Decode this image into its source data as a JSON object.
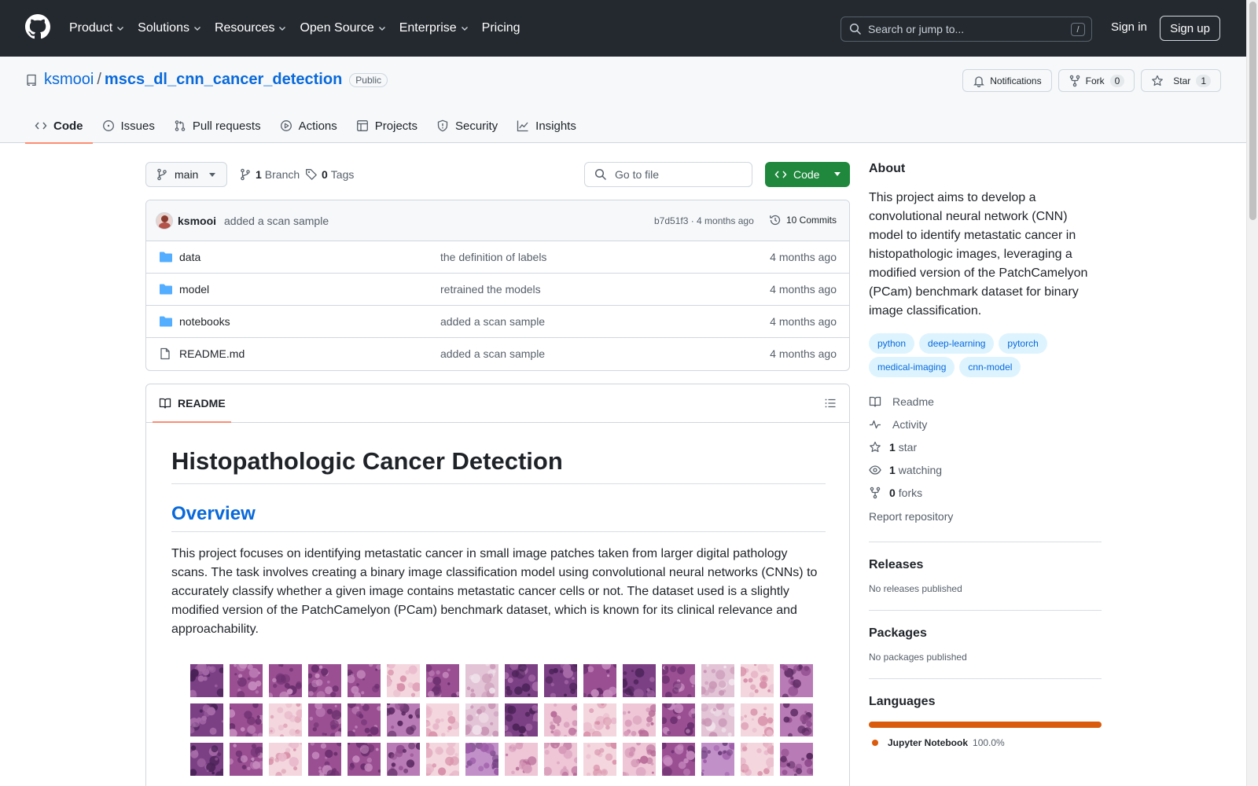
{
  "header": {
    "nav": [
      {
        "label": "Product",
        "has_menu": true
      },
      {
        "label": "Solutions",
        "has_menu": true
      },
      {
        "label": "Resources",
        "has_menu": true
      },
      {
        "label": "Open Source",
        "has_menu": true
      },
      {
        "label": "Enterprise",
        "has_menu": true
      },
      {
        "label": "Pricing",
        "has_menu": false
      }
    ],
    "search_placeholder": "Search or jump to...",
    "search_key": "/",
    "signin": "Sign in",
    "signup": "Sign up"
  },
  "repo": {
    "owner": "ksmooi",
    "separator": "/",
    "name": "mscs_dl_cnn_cancer_detection",
    "visibility": "Public",
    "notifications_label": "Notifications",
    "fork_label": "Fork",
    "fork_count": "0",
    "star_label": "Star",
    "star_count": "1",
    "tabs": [
      {
        "label": "Code",
        "icon": "code-icon",
        "active": true
      },
      {
        "label": "Issues",
        "icon": "issue-icon",
        "active": false
      },
      {
        "label": "Pull requests",
        "icon": "pull-request-icon",
        "active": false
      },
      {
        "label": "Actions",
        "icon": "play-icon",
        "active": false
      },
      {
        "label": "Projects",
        "icon": "table-icon",
        "active": false
      },
      {
        "label": "Security",
        "icon": "shield-icon",
        "active": false
      },
      {
        "label": "Insights",
        "icon": "graph-icon",
        "active": false
      }
    ]
  },
  "toolbar": {
    "branch": "main",
    "branch_count": "1",
    "branch_label": "Branch",
    "tag_count": "0",
    "tag_label": "Tags",
    "goto_placeholder": "Go to file",
    "code_button": "Code"
  },
  "commit": {
    "author": "ksmooi",
    "message": "added a scan sample",
    "hash_time": "b7d51f3 · 4 months ago",
    "commits_label": "10 Commits"
  },
  "files": [
    {
      "name": "data",
      "type": "folder",
      "message": "the definition of labels",
      "date": "4 months ago"
    },
    {
      "name": "model",
      "type": "folder",
      "message": "retrained the models",
      "date": "4 months ago"
    },
    {
      "name": "notebooks",
      "type": "folder",
      "message": "added a scan sample",
      "date": "4 months ago"
    },
    {
      "name": "README.md",
      "type": "file",
      "message": "added a scan sample",
      "date": "4 months ago"
    }
  ],
  "readme": {
    "tab_label": "README",
    "h1": "Histopathologic Cancer Detection",
    "h2": "Overview",
    "paragraph": "This project focuses on identifying metastatic cancer in small image patches taken from larger digital pathology scans. The task involves creating a binary image classification model using convolutional neural networks (CNNs) to accurately classify whether a given image contains metastatic cancer cells or not. The dataset used is a slightly modified version of the PatchCamelyon (PCam) benchmark dataset, which is known for its clinical relevance and approachability."
  },
  "sidebar": {
    "about_title": "About",
    "about_text": "This project aims to develop a convolutional neural network (CNN) model to identify metastatic cancer in histopathologic images, leveraging a modified version of the PatchCamelyon (PCam) benchmark dataset for binary image classification.",
    "topics": [
      "python",
      "deep-learning",
      "pytorch",
      "medical-imaging",
      "cnn-model"
    ],
    "links": [
      {
        "icon": "book-icon",
        "count": "",
        "label": "Readme"
      },
      {
        "icon": "pulse-icon",
        "count": "",
        "label": "Activity"
      },
      {
        "icon": "star-icon",
        "count": "1",
        "label": "star"
      },
      {
        "icon": "eye-icon",
        "count": "1",
        "label": "watching"
      },
      {
        "icon": "fork-icon",
        "count": "0",
        "label": "forks"
      }
    ],
    "report": "Report repository",
    "releases_title": "Releases",
    "releases_text": "No releases published",
    "packages_title": "Packages",
    "packages_text": "No packages published",
    "languages_title": "Languages",
    "languages": [
      {
        "name": "Jupyter Notebook",
        "percent": "100.0%",
        "color": "#da5b0b"
      }
    ]
  },
  "colors": {
    "header_bg": "#24292f",
    "link": "#0969da",
    "primary_button": "#1f883d",
    "tab_underline": "#fd8c73",
    "folder": "#54aeff"
  }
}
